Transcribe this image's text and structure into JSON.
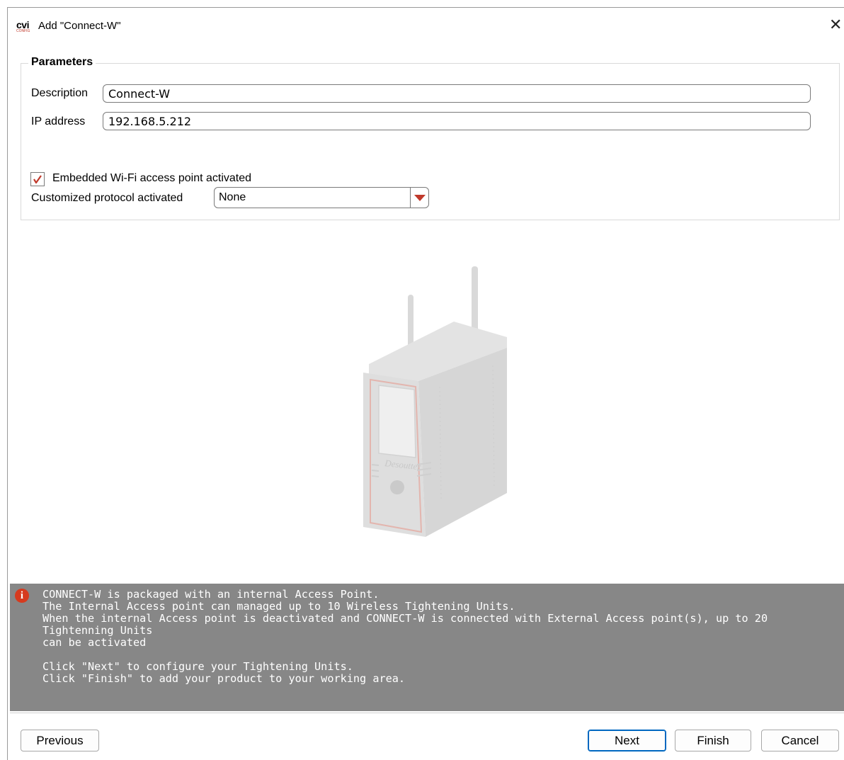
{
  "window": {
    "logo_text": "cvi",
    "logo_subtext": "CONFIG",
    "title": "Add \"Connect-W\"",
    "close_symbol": "✕"
  },
  "parameters": {
    "legend": "Parameters",
    "description_label": "Description",
    "description_value": "Connect-W",
    "ip_label": "IP address",
    "ip_value": "192.168.5.212",
    "wifi_checkbox_label": "Embedded Wi-Fi access point activated",
    "wifi_checked": true,
    "protocol_label": "Customized protocol activated",
    "protocol_value": "None"
  },
  "image": {
    "device_brand": "Desoutter"
  },
  "info": {
    "icon": "i",
    "text": "CONNECT-W is packaged with an internal Access Point.\nThe Internal Access point can managed up to 10 Wireless Tightening Units.\nWhen the internal Access point is deactivated and CONNECT-W is connected with External Access point(s), up to 20 Tightenning Units\ncan be activated\n\nClick \"Next\" to configure your Tightening Units.\nClick \"Finish\" to add your product to your working area."
  },
  "buttons": {
    "previous": "Previous",
    "next": "Next",
    "finish": "Finish",
    "cancel": "Cancel"
  },
  "colors": {
    "accent_red": "#c0392b",
    "info_bar": "#878787",
    "primary_border": "#0067c0"
  }
}
